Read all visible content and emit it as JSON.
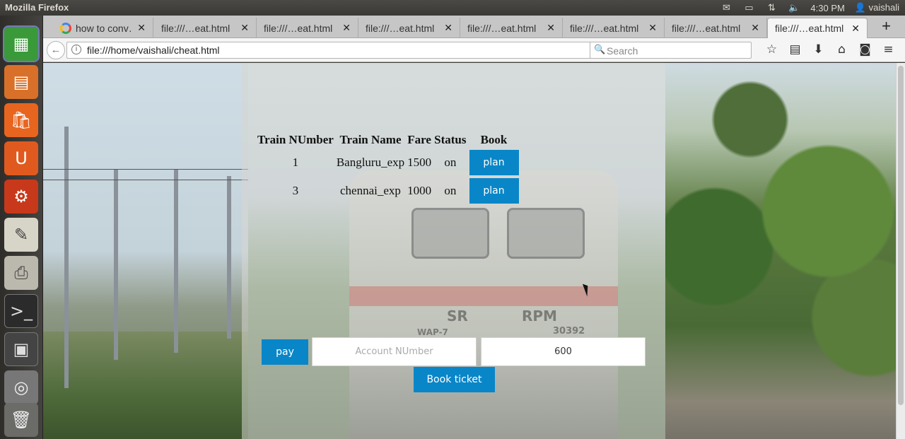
{
  "system": {
    "window_title": "Mozilla Firefox",
    "time": "4:30 PM",
    "user": "vaishali"
  },
  "tabs": [
    {
      "label": "how to conv…",
      "icon": "google-icon"
    },
    {
      "label": "file:///…eat.html"
    },
    {
      "label": "file:///…eat.html"
    },
    {
      "label": "file:///…eat.html"
    },
    {
      "label": "file:///…eat.html"
    },
    {
      "label": "file:///…eat.html"
    },
    {
      "label": "file:///…eat.html"
    },
    {
      "label": "file:///…eat.html",
      "selected": true
    }
  ],
  "navbar": {
    "url": "file:///home/vaishali/cheat.html",
    "search_placeholder": "Search"
  },
  "table": {
    "headers": [
      "Train NUmber",
      "Train Name",
      "Fare",
      "Status",
      "Book"
    ],
    "rows": [
      {
        "number": "1",
        "name": "Bangluru_exp",
        "fare": "1500",
        "status": "on",
        "button": "plan"
      },
      {
        "number": "3",
        "name": "chennai_exp",
        "fare": "1000",
        "status": "on",
        "button": "plan"
      }
    ]
  },
  "payment": {
    "pay_label": "pay",
    "account_placeholder": "Account NUmber",
    "amount_value": "600",
    "book_label": "Book ticket"
  },
  "background_text": {
    "loco_left": "SR",
    "loco_right": "RPM",
    "loco_model": "WAP-7",
    "loco_number": "30392"
  },
  "colors": {
    "button_blue": "#0986c8"
  }
}
